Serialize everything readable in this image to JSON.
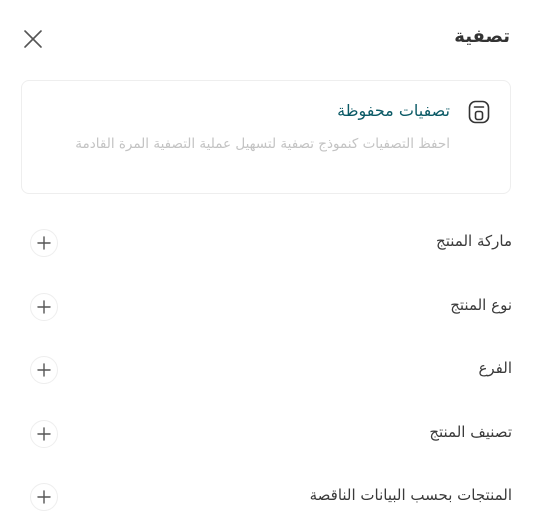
{
  "header": {
    "title": "تصفية",
    "close_icon": "close-icon"
  },
  "saved_filters": {
    "icon": "bookmark-save-icon",
    "title": "تصفيات محفوظة",
    "description": "احفظ التصفيات كنموذج تصفية لتسهيل عملية التصفية المرة القادمة"
  },
  "sections": [
    {
      "label": "ماركة المنتج",
      "icon": "plus-icon"
    },
    {
      "label": "نوع المنتج",
      "icon": "plus-icon"
    },
    {
      "label": "الفرع",
      "icon": "plus-icon"
    },
    {
      "label": "تصنيف المنتج",
      "icon": "plus-icon"
    },
    {
      "label": "المنتجات بحسب البيانات الناقصة",
      "icon": "plus-icon"
    }
  ]
}
